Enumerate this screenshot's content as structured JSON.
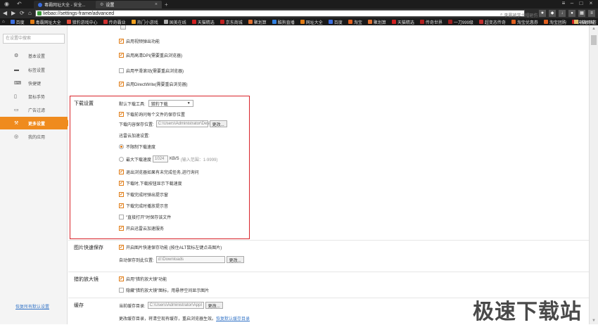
{
  "tabs": [
    {
      "label": "毒霸网址大全 - 安全..."
    },
    {
      "label": "设置"
    }
  ],
  "address": {
    "url": "liebao://settings-frame/advanced",
    "search_placeholder": "李晨被学士帽砸伤"
  },
  "bookmarks": [
    {
      "label": "百度",
      "color": "#3b6ee0"
    },
    {
      "label": "毒霸网址大全",
      "color": "#e07b14"
    },
    {
      "label": "猎豹游戏中心",
      "color": "#e04a3a"
    },
    {
      "label": "传奇霸业",
      "color": "#d03030"
    },
    {
      "label": "热门小游戏",
      "color": "#f0a020"
    },
    {
      "label": "国美在线",
      "color": "#b0b0b0"
    },
    {
      "label": "天猫精选",
      "color": "#d02020"
    },
    {
      "label": "京东商城",
      "color": "#c02020"
    },
    {
      "label": "聚划算",
      "color": "#e07030"
    },
    {
      "label": "酷狗直播",
      "color": "#3080e0"
    },
    {
      "label": "网址大全",
      "color": "#e07b14"
    },
    {
      "label": "百度",
      "color": "#3b6ee0"
    },
    {
      "label": "淘宝",
      "color": "#e06020"
    },
    {
      "label": "聚划算",
      "color": "#e07030"
    },
    {
      "label": "天猫精选",
      "color": "#d02020"
    },
    {
      "label": "传奇世界",
      "color": "#b02020"
    },
    {
      "label": "一刀999级",
      "color": "#a02020"
    },
    {
      "label": "超变态传奇",
      "color": "#c03030"
    },
    {
      "label": "淘宝优惠券",
      "color": "#e06020"
    },
    {
      "label": "淘宝团购",
      "color": "#e06020"
    },
    {
      "label": "天猫商城",
      "color": "#d02020"
    }
  ],
  "bookmarks_right": "其他书签",
  "sidebar": {
    "search_placeholder": "在设置中搜索",
    "items": [
      {
        "label": "基本设置",
        "icon": "gear-icon"
      },
      {
        "label": "标签设置",
        "icon": "tab-icon"
      },
      {
        "label": "快捷键",
        "icon": "keyboard-icon"
      },
      {
        "label": "鼠标手势",
        "icon": "mouse-icon"
      },
      {
        "label": "广告过滤",
        "icon": "filter-icon"
      },
      {
        "label": "更多设置",
        "icon": "more-icon"
      },
      {
        "label": "我的应用",
        "icon": "apps-icon"
      }
    ],
    "active_index": 5,
    "reset_link": "恢复所有默认设置"
  },
  "top": {
    "options": [
      {
        "label": "启用视频弹出功能",
        "checked": true
      },
      {
        "label": "启用高清DPI(需要重启浏览器)",
        "checked": true
      },
      {
        "label": "启用平滑滚动(需要重启浏览器)",
        "checked": false
      },
      {
        "label": "启用DirectWrite(需要重启浏览器)",
        "checked": true
      }
    ]
  },
  "download": {
    "title": "下载设置",
    "tool_label": "默认下载工具:",
    "tool_value": "猎豹下载",
    "ask_label": "下载前询问每个文件的保存位置",
    "path_label": "下载内容保存位置:",
    "path_value": "C:\\Users\\Administrator\\Desk",
    "change": "更改...",
    "cloud_label": "迅雷云加速设置:",
    "unlimited_label": "不限制下载速度",
    "max_label": "最大下载速度",
    "max_value": "1024",
    "max_unit": "KB/S",
    "max_hint": "(输入范围：1-9999)",
    "options": [
      {
        "label": "退出浏览器如果有未完成任务,进行询问",
        "checked": true
      },
      {
        "label": "下载时,下载按钮显示下载速度",
        "checked": true
      },
      {
        "label": "下载完成时弹出提示窗",
        "checked": true
      },
      {
        "label": "下载完成时播放提示音",
        "checked": true
      },
      {
        "label": "\"直接打开\"时保存该文件",
        "checked": false
      },
      {
        "label": "开启迅雷云加速服务",
        "checked": true
      }
    ]
  },
  "image": {
    "title": "图片快速保存",
    "opt": "开启图片快速保存功能 (按住ALT鼠标左键点击图片)",
    "path_label": "自动保存到此位置:",
    "path_value": "d:\\Downloads",
    "change": "更改..."
  },
  "zoom": {
    "title": "猎豹放大镜",
    "opt1": "启用\"猎豹放大镜\"功能",
    "opt2": "隐藏\"猎豹放大镜\"图标，用悬停空间显示图片"
  },
  "cache": {
    "title": "缓存",
    "path_label": "当前缓存目录:",
    "path_value": "C:\\Users\\Administrator\\AppI",
    "change": "更改...",
    "note": "更改缓存目录，将清空现有缓存，重启浏览器生效。",
    "restore": "恢复默认缓存目录"
  },
  "watermark": "极速下载站"
}
